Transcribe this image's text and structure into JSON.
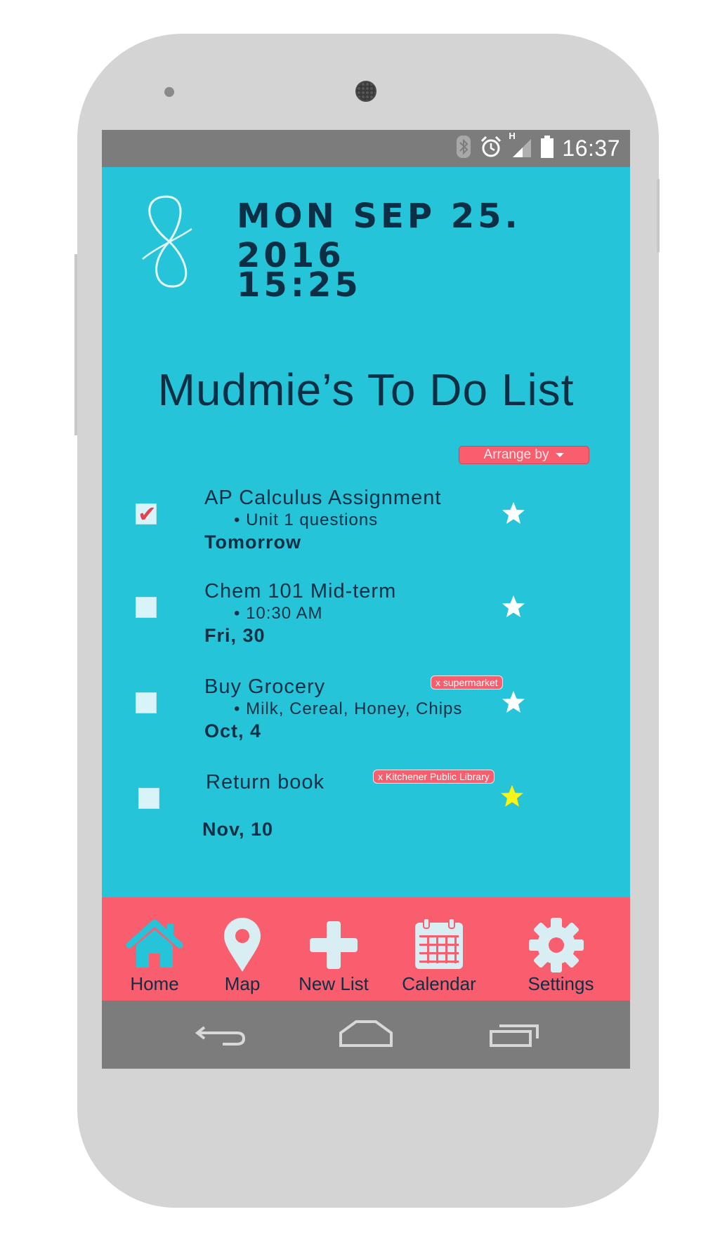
{
  "status": {
    "time": "16:37",
    "icons": [
      "bluetooth-icon",
      "alarm-icon",
      "signal-icon",
      "battery-icon"
    ],
    "signal_label": "H"
  },
  "header": {
    "date": "MON SEP 25. 2016",
    "time": "15:25",
    "logo_icon": "infinity-logo"
  },
  "list": {
    "title": "Mudmie’s To Do List",
    "arrange_label": "Arrange by",
    "tasks": [
      {
        "title": "AP Calculus Assignment",
        "detail": "• Unit 1 questions",
        "due": "Tomorrow",
        "checked": true,
        "starred": false,
        "tag": ""
      },
      {
        "title": "Chem 101 Mid-term",
        "detail": "• 10:30 AM",
        "due": "Fri, 30",
        "checked": false,
        "starred": false,
        "tag": ""
      },
      {
        "title": "Buy Grocery",
        "detail": "• Milk, Cereal, Honey, Chips",
        "due": "Oct, 4",
        "checked": false,
        "starred": false,
        "tag": "x supermarket"
      },
      {
        "title": "Return book",
        "detail": "",
        "due": "Nov, 10",
        "checked": false,
        "starred": true,
        "tag": "x Kitchener Public Library"
      }
    ]
  },
  "nav": {
    "items": [
      {
        "label": "Home",
        "icon": "home-icon"
      },
      {
        "label": "Map",
        "icon": "map-pin-icon"
      },
      {
        "label": "New List",
        "icon": "plus-icon"
      },
      {
        "label": "Calendar",
        "icon": "calendar-icon"
      },
      {
        "label": "Settings",
        "icon": "gear-icon"
      }
    ]
  },
  "colors": {
    "app_bg": "#25c4d8",
    "accent": "#f95e6e",
    "text": "#0d2f45",
    "star_active": "#f5f51a",
    "star_inactive": "#ffffff",
    "status_bar": "#7c7c7c"
  }
}
